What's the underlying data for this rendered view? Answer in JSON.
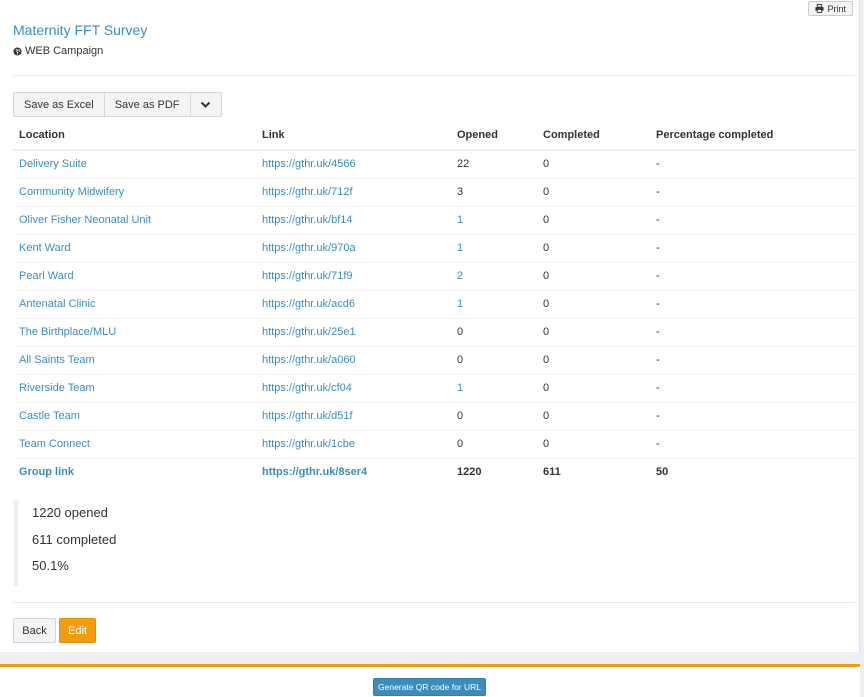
{
  "header": {
    "print_label": "Print",
    "title": "Maternity FFT Survey",
    "campaign": "WEB Campaign"
  },
  "toolbar": {
    "save_excel": "Save as Excel",
    "save_pdf": "Save as PDF"
  },
  "table": {
    "headers": [
      "Location",
      "Link",
      "Opened",
      "Completed",
      "Percentage completed"
    ],
    "rows": [
      {
        "location": "Delivery Suite",
        "link": "https://gthr.uk/4566",
        "opened": "22",
        "completed": "0",
        "percent": "-",
        "opened_link": false
      },
      {
        "location": "Community Midwifery",
        "link": "https://gthr.uk/712f",
        "opened": "3",
        "completed": "0",
        "percent": "-",
        "opened_link": false
      },
      {
        "location": "Oliver Fisher Neonatal Unit",
        "link": "https://gthr.uk/bf14",
        "opened": "1",
        "completed": "0",
        "percent": "-",
        "opened_link": true
      },
      {
        "location": "Kent Ward",
        "link": "https://gthr.uk/970a",
        "opened": "1",
        "completed": "0",
        "percent": "-",
        "opened_link": true
      },
      {
        "location": "Pearl Ward",
        "link": "https://gthr.uk/71f9",
        "opened": "2",
        "completed": "0",
        "percent": "-",
        "opened_link": true
      },
      {
        "location": "Antenatal Clinic",
        "link": "https://gthr.uk/acd6",
        "opened": "1",
        "completed": "0",
        "percent": "-",
        "opened_link": true
      },
      {
        "location": "The Birthplace/MLU",
        "link": "https://gthr.uk/25e1",
        "opened": "0",
        "completed": "0",
        "percent": "-",
        "opened_link": false
      },
      {
        "location": "All Saints Team",
        "link": "https://gthr.uk/a060",
        "opened": "0",
        "completed": "0",
        "percent": "-",
        "opened_link": false
      },
      {
        "location": "Riverside Team",
        "link": "https://gthr.uk/cf04",
        "opened": "1",
        "completed": "0",
        "percent": "-",
        "opened_link": true
      },
      {
        "location": "Castle Team",
        "link": "https://gthr.uk/d51f",
        "opened": "0",
        "completed": "0",
        "percent": "-",
        "opened_link": false
      },
      {
        "location": "Team Connect",
        "link": "https://gthr.uk/1cbe",
        "opened": "0",
        "completed": "0",
        "percent": "-",
        "opened_link": false
      }
    ],
    "group": {
      "location": "Group link",
      "link": "https://gthr.uk/8ser4",
      "opened": "1220",
      "completed": "611",
      "percent": "50"
    }
  },
  "summary": {
    "opened": "1220 opened",
    "completed": "611 completed",
    "percent": "50.1%"
  },
  "actions": {
    "back": "Back",
    "edit": "Edit"
  },
  "footer": {
    "qr_button": "Generate QR code for URL"
  },
  "colors": {
    "link": "#3c8dbc",
    "warning": "#f39c12",
    "primary": "#3c8dbc"
  }
}
